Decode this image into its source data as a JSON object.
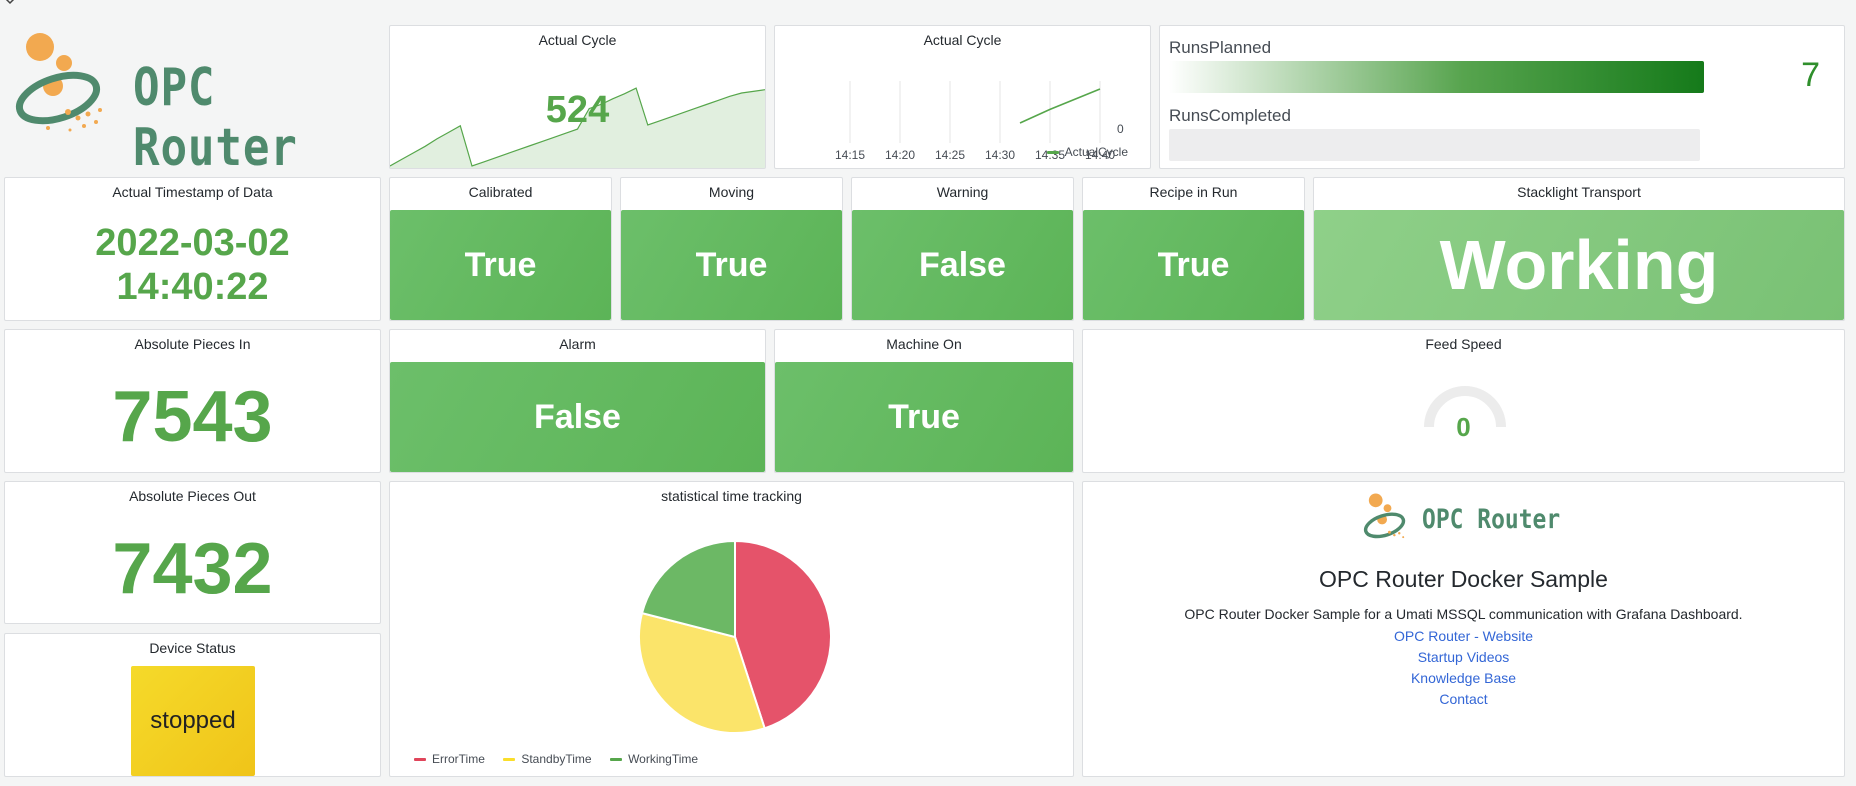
{
  "brand": {
    "name": "OPC Router"
  },
  "colors": {
    "green": "#56a64b",
    "tile_green": "#5cb457",
    "red": "#e0455b",
    "yellow": "#fade2a",
    "link": "#3366d6"
  },
  "actual_cycle_1": {
    "title": "Actual Cycle",
    "value": "524",
    "chart_data": {
      "type": "area",
      "values": [
        0,
        8,
        16,
        24,
        33,
        41,
        49,
        0,
        5,
        10,
        15,
        20,
        25,
        30,
        35,
        40,
        45,
        70,
        75,
        82,
        88,
        95,
        50,
        55,
        60,
        65,
        70,
        75,
        80,
        85,
        89,
        91,
        93
      ]
    }
  },
  "actual_cycle_2": {
    "title": "Actual Cycle",
    "chart_data": {
      "type": "line",
      "x": [
        "14:15",
        "14:20",
        "14:25",
        "14:30",
        "14:35",
        "14:40"
      ],
      "y_ticks": [
        "0"
      ],
      "series": [
        {
          "name": "ActualCycle",
          "x": [
            "14:32",
            "14:35",
            "14:40"
          ],
          "y": [
            0,
            0.4,
            1
          ]
        }
      ]
    }
  },
  "runs": {
    "planned_label": "RunsPlanned",
    "planned_value": "7",
    "planned_fraction": 1.0,
    "completed_label": "RunsCompleted",
    "completed_fraction": 0
  },
  "timestamp": {
    "title": "Actual Timestamp of Data",
    "date": "2022-03-02",
    "time": "14:40:22"
  },
  "calibrated": {
    "title": "Calibrated",
    "value": "True"
  },
  "moving": {
    "title": "Moving",
    "value": "True"
  },
  "warning": {
    "title": "Warning",
    "value": "False"
  },
  "recipe": {
    "title": "Recipe in Run",
    "value": "True"
  },
  "stacklight": {
    "title": "Stacklight Transport",
    "value": "Working"
  },
  "pieces_in": {
    "title": "Absolute Pieces In",
    "value": "7543"
  },
  "alarm": {
    "title": "Alarm",
    "value": "False"
  },
  "machine_on": {
    "title": "Machine On",
    "value": "True"
  },
  "feed_speed": {
    "title": "Feed Speed",
    "value": "0",
    "gauge_fraction": 0
  },
  "pieces_out": {
    "title": "Absolute Pieces Out",
    "value": "7432"
  },
  "time_tracking": {
    "title": "statistical time tracking",
    "chart_data": {
      "type": "pie",
      "series": [
        {
          "name": "ErrorTime",
          "value": 45,
          "color": "#e0455b"
        },
        {
          "name": "StandbyTime",
          "value": 34,
          "color": "#fade2a"
        },
        {
          "name": "WorkingTime",
          "value": 21,
          "color": "#56a64b"
        }
      ]
    }
  },
  "device_status": {
    "title": "Device Status",
    "value": "stopped"
  },
  "info": {
    "logo_text": "OPC Router",
    "heading": "OPC Router Docker Sample",
    "description": "OPC Router Docker Sample for a Umati MSSQL communication with Grafana Dashboard.",
    "links": [
      "OPC Router - Website",
      "Startup Videos",
      "Knowledge Base",
      "Contact"
    ]
  }
}
